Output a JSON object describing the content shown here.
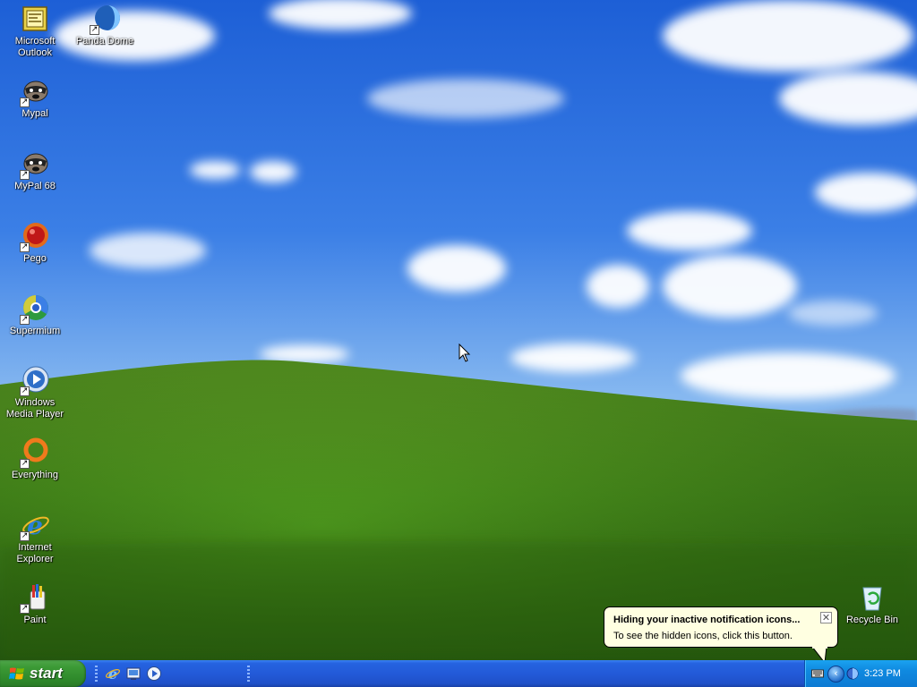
{
  "desktop": {
    "icons": [
      {
        "label": "Microsoft Outlook",
        "icon": "outlook-icon",
        "shortcut": false
      },
      {
        "label": "Panda Dome",
        "icon": "panda-dome-icon",
        "shortcut": true
      },
      {
        "label": "Mypal",
        "icon": "mypal-icon",
        "shortcut": true
      },
      {
        "label": "MyPal 68",
        "icon": "mypal-68-icon",
        "shortcut": true
      },
      {
        "label": "Pego",
        "icon": "pego-icon",
        "shortcut": true
      },
      {
        "label": "Supermium",
        "icon": "supermium-icon",
        "shortcut": true
      },
      {
        "label": "Windows Media Player",
        "icon": "windows-media-player-icon",
        "shortcut": true
      },
      {
        "label": "Everything",
        "icon": "everything-icon",
        "shortcut": true
      },
      {
        "label": "Internet Explorer",
        "icon": "internet-explorer-icon",
        "shortcut": true
      },
      {
        "label": "Paint",
        "icon": "paint-icon",
        "shortcut": true
      },
      {
        "label": "Recycle Bin",
        "icon": "recycle-bin-icon",
        "shortcut": false
      }
    ]
  },
  "taskbar": {
    "start_label": "start",
    "quick_launch": [
      {
        "icon": "internet-explorer-icon"
      },
      {
        "icon": "show-desktop-icon"
      },
      {
        "icon": "windows-media-player-icon"
      }
    ],
    "tray": {
      "clock": "3:23 PM",
      "icons": [
        "keyboard-icon",
        "show-hidden-icons-chevron-icon",
        "network-icon"
      ]
    }
  },
  "balloon": {
    "title": "Hiding your inactive notification icons...",
    "text": "To see the hidden icons, click this button.",
    "close_label": "✕"
  },
  "colors": {
    "taskbar": "#235ad8",
    "start_button": "#3c9a36",
    "tray": "#0f89e0",
    "balloon_bg": "#ffffe1",
    "sky": "#2f6fe0",
    "grass": "#4f9a1e"
  }
}
